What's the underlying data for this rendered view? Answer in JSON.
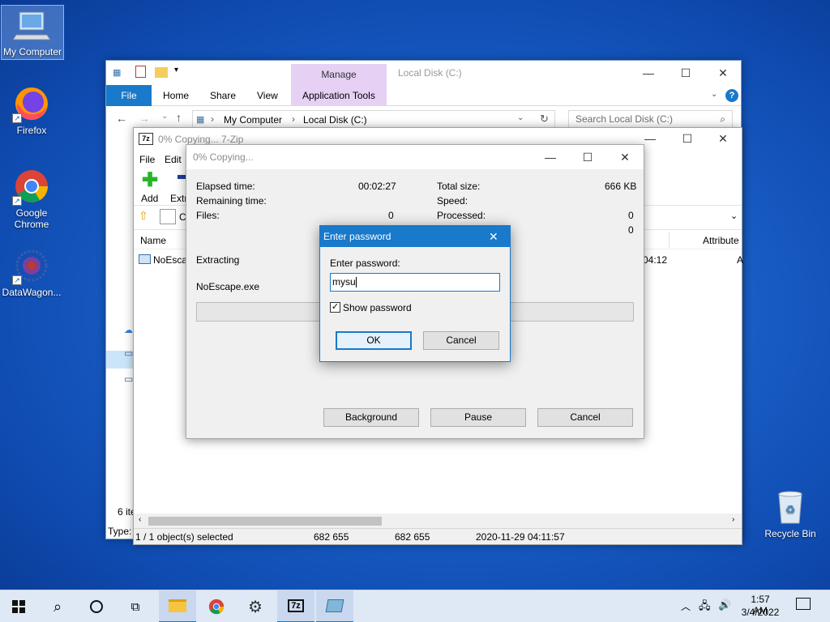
{
  "desktop": {
    "icons": [
      {
        "label": "My Computer"
      },
      {
        "label": "Firefox"
      },
      {
        "label": "Google Chrome"
      },
      {
        "label": "DataWagon..."
      },
      {
        "label": "Recycle Bin"
      }
    ]
  },
  "explorer": {
    "title": "Local Disk (C:)",
    "ribbon_context": "Manage",
    "tabs": [
      "File",
      "Home",
      "Share",
      "View",
      "Application Tools"
    ],
    "breadcrumb": [
      "My Computer",
      "Local Disk (C:)"
    ],
    "search_placeholder": "Search Local Disk (C:)",
    "column_attributes": "Attribute",
    "item_count": "6 ite",
    "type_label": "Type:"
  },
  "zip": {
    "title": "0% Copying... 7-Zip",
    "menu": [
      "File",
      "Edit"
    ],
    "toolbar": {
      "add": "Add",
      "extract": "Extr"
    },
    "path_prefix": "C",
    "column_name": "Name",
    "row_name": "NoEscap",
    "row_time": "04:12",
    "row_attr": "A",
    "status": {
      "selected": "1 / 1 object(s) selected",
      "size": "682 655",
      "packed": "682 655",
      "modified": "2020-11-29 04:11:57"
    }
  },
  "progress": {
    "title": "0% Copying...",
    "elapsed_label": "Elapsed time:",
    "elapsed_value": "00:02:27",
    "remaining_label": "Remaining time:",
    "files_label": "Files:",
    "files_value": "0",
    "total_label": "Total size:",
    "total_value": "666 KB",
    "speed_label": "Speed:",
    "processed_label": "Processed:",
    "processed_value": "0",
    "extra_value": "0",
    "action": "Extracting",
    "file": "NoEscape.exe",
    "progress_fraction": 0,
    "buttons": {
      "background": "Background",
      "pause": "Pause",
      "cancel": "Cancel"
    }
  },
  "password_dialog": {
    "title": "Enter password",
    "prompt": "Enter password:",
    "value": "mysu",
    "show_password_label": "Show password",
    "show_password_checked": true,
    "ok": "OK",
    "cancel": "Cancel"
  },
  "taskbar": {
    "time": "1:57 AM",
    "date": "3/4/2022"
  },
  "colors": {
    "accent": "#1979ca",
    "manage_tab": "#e6d1f5",
    "taskbar": "#dfe8f5"
  }
}
